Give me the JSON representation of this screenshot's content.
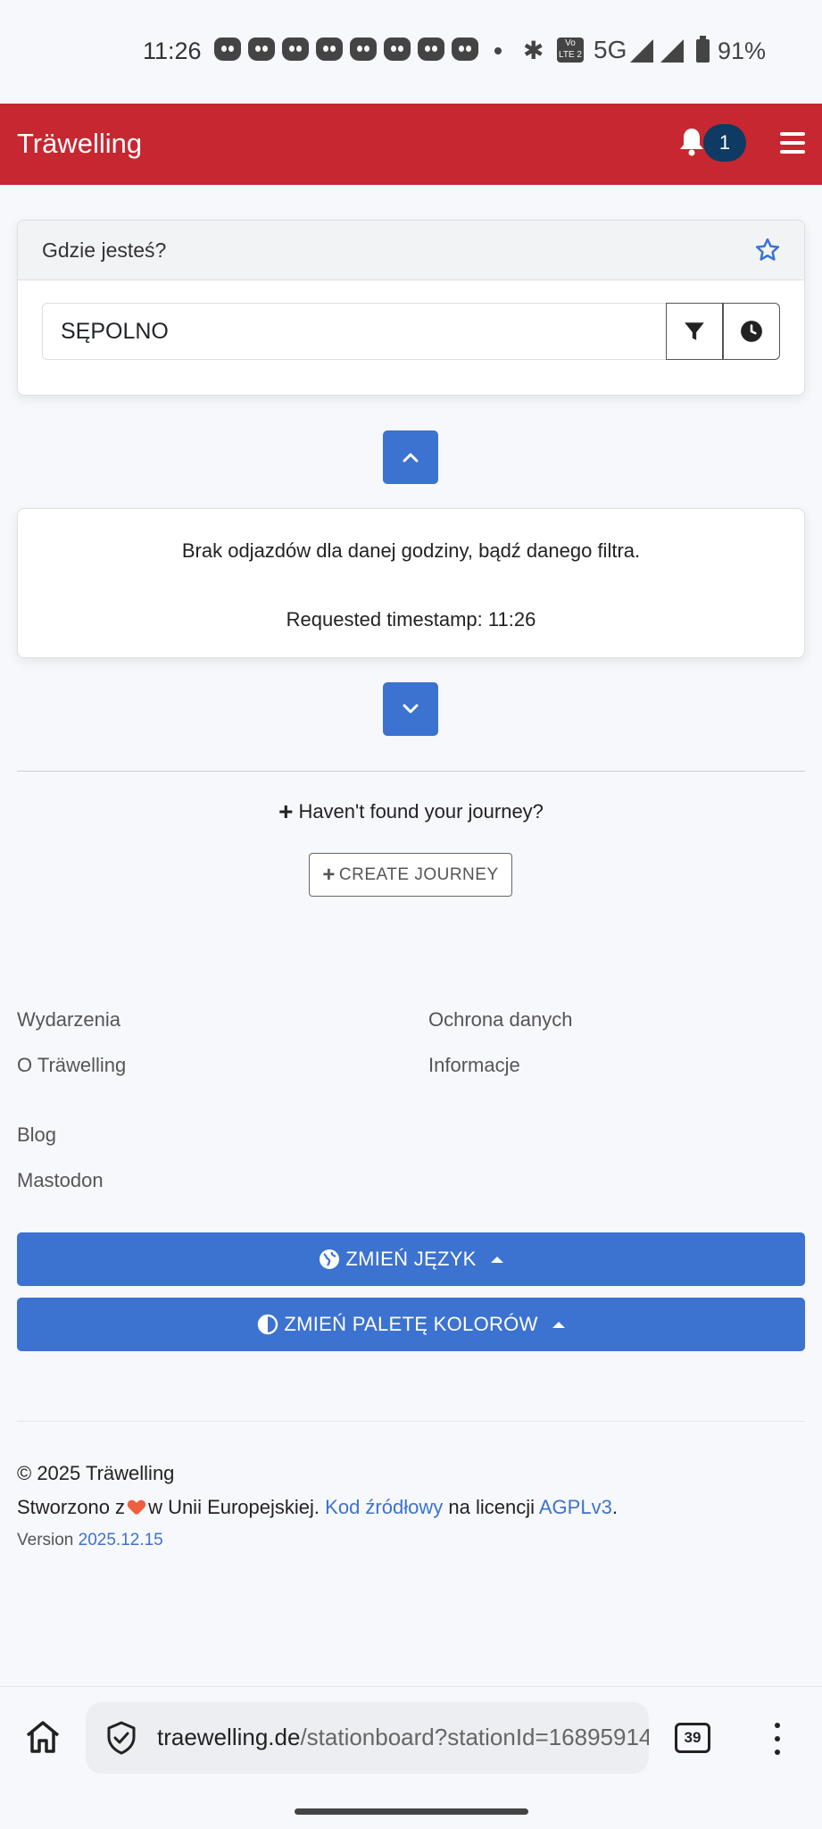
{
  "status_bar": {
    "time": "11:26",
    "network": "5G",
    "battery": "91%",
    "volte_label": "Vo LTE 2"
  },
  "navbar": {
    "brand": "Träwelling",
    "notification_count": "1"
  },
  "where_card": {
    "title": "Gdzie jesteś?",
    "station_value": "SĘPOLNO"
  },
  "departures": {
    "empty_message": "Brak odjazdów dla danej godziny, bądź danego filtra.",
    "requested_timestamp": "Requested timestamp: 11:26"
  },
  "journey": {
    "not_found_text": "Haven't found your journey?",
    "create_button": "CREATE JOURNEY"
  },
  "footer": {
    "links_left": [
      "Wydarzenia",
      "O Träwelling"
    ],
    "links_right": [
      "Ochrona danych",
      "Informacje"
    ],
    "links_bottom": [
      "Blog",
      "Mastodon"
    ],
    "change_language": "ZMIEŃ JĘZYK",
    "change_palette": "ZMIEŃ PALETĘ KOLORÓW",
    "copyright": "© 2025 Träwelling",
    "made_prefix": "Stworzono z",
    "made_suffix": "w Unii Europejskiej.",
    "source_link": "Kod źródłowy",
    "license_text": "na licencji",
    "license_link": "AGPLv3",
    "license_end": ".",
    "version_label": "Version",
    "version_value": "2025.12.15"
  },
  "browser": {
    "url_domain": "traewelling.de",
    "url_path": "/stationboard?stationId=16895914",
    "tab_count": "39"
  },
  "colors": {
    "navbar_red": "#c72730",
    "primary_blue": "#3c72d0",
    "badge_navy": "#0e3a63"
  }
}
